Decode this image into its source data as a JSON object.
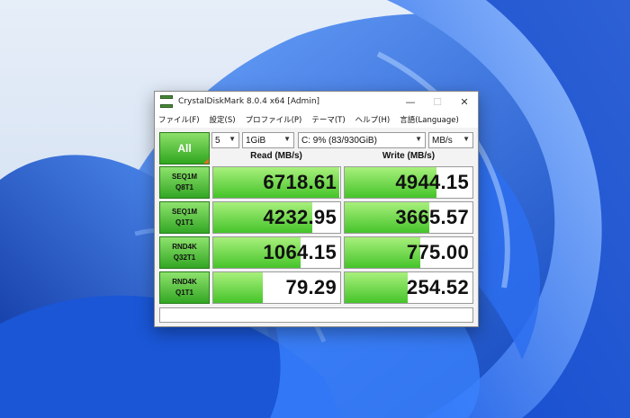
{
  "window": {
    "title": "CrystalDiskMark 8.0.4 x64 [Admin]",
    "controls": {
      "minimize": "—",
      "maximize": "☐",
      "close": "✕"
    }
  },
  "menu": [
    "ファイル(F)",
    "設定(S)",
    "プロファイル(P)",
    "テーマ(T)",
    "ヘルプ(H)",
    "言語(Language)"
  ],
  "toolbar": {
    "all_label": "All",
    "count": "5",
    "size": "1GiB",
    "drive": "C: 9% (83/930GiB)",
    "unit": "MB/s"
  },
  "headers": {
    "read": "Read (MB/s)",
    "write": "Write (MB/s)"
  },
  "tests": [
    {
      "label_line1": "SEQ1M",
      "label_line2": "Q8T1",
      "read": "6718.61",
      "write": "4944.15",
      "read_fill": 0.99,
      "write_fill": 0.72
    },
    {
      "label_line1": "SEQ1M",
      "label_line2": "Q1T1",
      "read": "4232.95",
      "write": "3665.57",
      "read_fill": 0.78,
      "write_fill": 0.66
    },
    {
      "label_line1": "RND4K",
      "label_line2": "Q32T1",
      "read": "1064.15",
      "write": "775.00",
      "read_fill": 0.69,
      "write_fill": 0.59
    },
    {
      "label_line1": "RND4K",
      "label_line2": "Q1T1",
      "read": "79.29",
      "write": "254.52",
      "read_fill": 0.39,
      "write_fill": 0.49
    }
  ],
  "comment": "",
  "colors": {
    "accent_green": "#46c42a",
    "wallpaper_blue": "#1f5fd6"
  }
}
